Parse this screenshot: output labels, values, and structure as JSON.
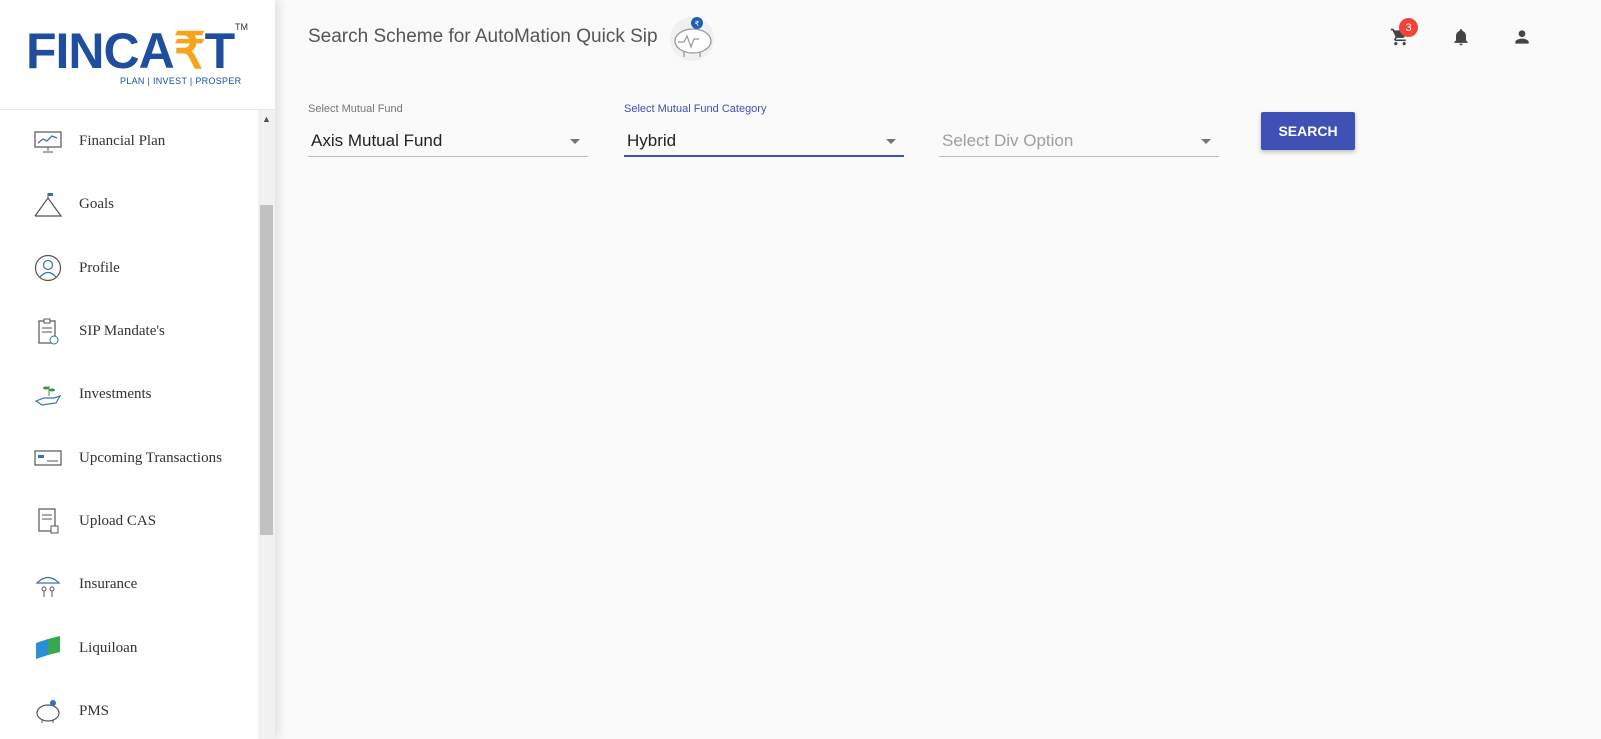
{
  "brand": {
    "logo_text": "FINCA",
    "logo_rupee": "₹",
    "logo_end": "T",
    "tm": "TM",
    "tagline": "PLAN | INVEST | PROSPER",
    "primary_color": "#1f4e9e",
    "accent_color": "#f4a51c"
  },
  "header": {
    "title": "Search Scheme for AutoMation Quick Sip",
    "cart_count": "3",
    "icons": [
      "cart-icon",
      "bell-icon",
      "account-icon"
    ]
  },
  "sidebar": {
    "items": [
      {
        "label": "Financial Plan",
        "icon": "chart-monitor-icon"
      },
      {
        "label": "Goals",
        "icon": "mountain-flag-icon"
      },
      {
        "label": "Profile",
        "icon": "user-circle-icon"
      },
      {
        "label": "SIP Mandate's",
        "icon": "clipboard-check-icon"
      },
      {
        "label": "Investments",
        "icon": "hand-plant-icon"
      },
      {
        "label": "Upcoming Transactions",
        "icon": "cheque-icon"
      },
      {
        "label": "Upload CAS",
        "icon": "document-upload-icon"
      },
      {
        "label": "Insurance",
        "icon": "umbrella-family-icon"
      },
      {
        "label": "Liquiloan",
        "icon": "liquiloan-icon"
      },
      {
        "label": "PMS",
        "icon": "piggy-bank-icon"
      }
    ]
  },
  "form": {
    "mutual_fund": {
      "label": "Select Mutual Fund",
      "value": "Axis Mutual Fund"
    },
    "category": {
      "label": "Select Mutual Fund Category",
      "value": "Hybrid"
    },
    "div_option": {
      "placeholder": "Select Div Option"
    },
    "search_label": "SEARCH",
    "accent_color": "#3f51b5"
  }
}
